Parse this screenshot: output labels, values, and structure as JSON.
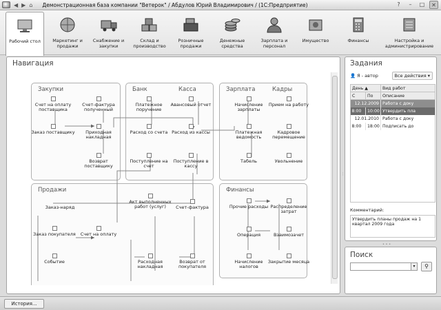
{
  "window": {
    "title": "Демонстрационная база компании \"Ветерок\" / Абдулов Юрий Владимирович / (1С:Предприятие)"
  },
  "sections": [
    {
      "id": "desktop",
      "label": "Рабочий стол",
      "icon": "desktop-icon",
      "active": true
    },
    {
      "id": "marketing",
      "label": "Маркетинг и продажи",
      "icon": "globe-icon"
    },
    {
      "id": "supply",
      "label": "Снабжение и закупки",
      "icon": "truck-icon"
    },
    {
      "id": "warehouse",
      "label": "Склад и производство",
      "icon": "boxes-icon"
    },
    {
      "id": "retail",
      "label": "Розничные продажи",
      "icon": "cash-register-icon"
    },
    {
      "id": "cash",
      "label": "Денежные средства",
      "icon": "coins-icon"
    },
    {
      "id": "salary",
      "label": "Зарплата и персонал",
      "icon": "person-icon"
    },
    {
      "id": "property",
      "label": "Имущество",
      "icon": "gear-box-icon"
    },
    {
      "id": "finance",
      "label": "Финансы",
      "icon": "calculator-icon"
    },
    {
      "id": "admin",
      "label": "Настройка и администрирование",
      "icon": "settings-icon"
    }
  ],
  "nav": {
    "title": "Навигация",
    "groups": {
      "zakupki": {
        "title": "Закупки",
        "items": [
          "Счет на оплату поставщика",
          "Счет-фактура полученный",
          "Заказ поставщику",
          "Приходная накладная",
          "Возврат поставщику"
        ]
      },
      "bank": {
        "title": "Банк",
        "items": [
          "Платежное поручение",
          "Расход со счета",
          "Поступление на счет"
        ]
      },
      "kassa": {
        "title": "Касса",
        "items": [
          "Авансовый отчет",
          "Расход из кассы",
          "Поступление в кассу"
        ]
      },
      "zarplata": {
        "title": "Зарплата",
        "items": [
          "Начисление зарплаты",
          "Платежная ведомость",
          "Табель"
        ]
      },
      "kadry": {
        "title": "Кадры",
        "items": [
          "Прием на работу",
          "Кадровое перемещение",
          "Увольнение"
        ]
      },
      "prodazhi": {
        "title": "Продажи",
        "items": [
          "Заказ-наряд",
          "Заказ покупателя",
          "Счет на оплату",
          "Событие",
          "Акт выполненных работ (услуг)",
          "Счет-фактура",
          "Расходная накладная",
          "Возврат от покупателя"
        ]
      },
      "finansy": {
        "title": "Финансы",
        "items": [
          "Прочие расходы",
          "Распределение затрат",
          "Операция",
          "Взаимозачет",
          "Начисление налогов",
          "Закрытие месяца"
        ]
      }
    }
  },
  "tasks": {
    "title": "Задания",
    "author_button": "Я - автор",
    "all_actions": "Все действия",
    "columns": [
      "С",
      "По",
      "День",
      "Вид работ",
      "Описание"
    ],
    "rows": [
      {
        "from": "",
        "to": "",
        "date": "12.12.2009",
        "text": "Работа с доку",
        "style": "sel"
      },
      {
        "from": "8:00",
        "to": "10:00",
        "date": "",
        "text": "Утвердить пла",
        "style": "sel2"
      },
      {
        "from": "",
        "to": "",
        "date": "12.01.2010",
        "text": "Работа с доку",
        "style": ""
      },
      {
        "from": "8:00",
        "to": "18:00",
        "date": "",
        "text": "Подписать до",
        "style": ""
      }
    ],
    "comment_label": "Комментарий:",
    "comment": "Утвердить планы продаж на 1 квартал 2009 года"
  },
  "search": {
    "title": "Поиск",
    "value": "",
    "go_icon": "binoculars-icon"
  },
  "footer": {
    "history_button": "История..."
  }
}
